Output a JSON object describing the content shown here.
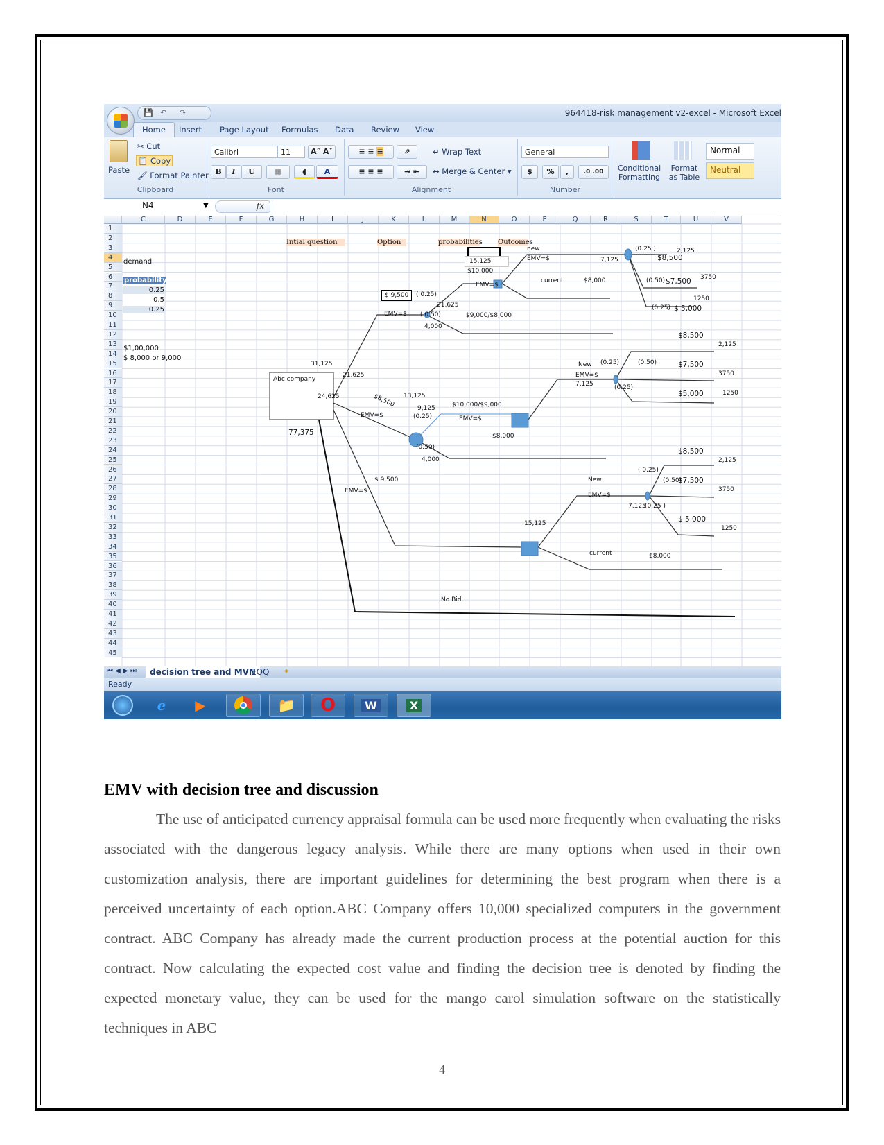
{
  "excel": {
    "window_title": "964418-risk management v2-excel - Microsoft Excel",
    "ribbon_tabs": [
      "Home",
      "Insert",
      "Page Layout",
      "Formulas",
      "Data",
      "Review",
      "View"
    ],
    "clipboard": {
      "paste": "Paste",
      "cut": "Cut",
      "copy": "Copy",
      "format_painter": "Format Painter",
      "label": "Clipboard"
    },
    "font": {
      "name": "Calibri",
      "size": "11",
      "bold": "B",
      "italic": "I",
      "underline": "U",
      "label": "Font"
    },
    "alignment": {
      "wrap_text": "Wrap Text",
      "merge_center": "Merge & Center",
      "label": "Alignment"
    },
    "number": {
      "format": "General",
      "currency": "$",
      "percent": "%",
      "comma": ",",
      "label": "Number"
    },
    "styles": {
      "conditional_formatting": "Conditional Formatting",
      "format_as_table": "Format as Table",
      "normal": "Normal",
      "neutral": "Neutral"
    },
    "name_box": "N4",
    "fx_label": "fx",
    "columns": [
      "C",
      "D",
      "E",
      "F",
      "G",
      "H",
      "I",
      "J",
      "K",
      "L",
      "M",
      "N",
      "O",
      "P",
      "Q",
      "R",
      "S",
      "T",
      "U",
      "V"
    ],
    "selected_column": "N",
    "rows": [
      "1",
      "2",
      "3",
      "4",
      "5",
      "6",
      "7",
      "8",
      "9",
      "10",
      "11",
      "12",
      "13",
      "14",
      "15",
      "16",
      "17",
      "18",
      "19",
      "20",
      "21",
      "22",
      "23",
      "24",
      "25",
      "26",
      "27",
      "28",
      "29",
      "30",
      "31",
      "32",
      "33",
      "34",
      "35",
      "36",
      "37",
      "38",
      "39",
      "40",
      "41",
      "42",
      "43",
      "44",
      "45"
    ],
    "selected_row": "4",
    "cells": {
      "demand": "demand",
      "probability_header": "probability",
      "probabilities": [
        "0.25",
        "0.5",
        "0.25"
      ],
      "amount_1": "$1,00,000",
      "amount_2": "$ 8,000 or 9,000",
      "initial_question": "Intial question",
      "option": "Option",
      "probabilities_header": "probabilities",
      "outcomes": "Outcomes"
    },
    "tree_labels": {
      "root": "Abc company",
      "root_total": "77,375",
      "v31125": "31,125",
      "v21625_a": "21,625",
      "v24625": "24,625",
      "bid_9500_box": "$ 9,500",
      "emv_a": "EMV=$",
      "p025_a": "( 0.25)",
      "p050_a": "( 0.50)",
      "v21625_b": "21,625",
      "v4000_a": "4,000",
      "s9000_8000": "$9,000/$8,000",
      "v15125_box": "15,125",
      "v10000": "$10,000",
      "emv_b": "EMV=$",
      "new_a": "new",
      "emv_new_a": "EMV=$",
      "current_a": "current",
      "current_a_val": "$8,000",
      "v7125_a": "7,125",
      "p025_b": "(0.25 )",
      "s8500_a": "$8,500",
      "v2125_a": "2,125",
      "p050_b": "(0.50)",
      "s7500_a": "$7,500",
      "v3750_a": "3750",
      "v1250_a": "1250",
      "p025_c": "(0.25)",
      "s5000_a": "$ 5,000",
      "bid_8500_diag": "$8,500",
      "emv_c": "EMV=$",
      "v13125": "13,125",
      "v9125": "9,125",
      "p025_d": "(0.25)",
      "s10000_9000": "$10,000/$9,000",
      "emv_d": "EMV=$",
      "s8000_b": "$8,000",
      "p050_c": "(0.50)",
      "v4000_b": "4,000",
      "new_b": "New",
      "p025_e": "(0.25)",
      "emv_new_b": "EMV=$",
      "v7125_b": "7,125",
      "p050_d": "(0.50)",
      "p025_f": "(0.25)",
      "s8500_b": "$8,500",
      "v2125_b": "2,125",
      "s7500_b": "$7,500",
      "v3750_b": "3750",
      "s5000_b": "$5,000",
      "v1250_b": "1250",
      "bid_9500_diag": "$ 9,500",
      "emv_e": "EMV=$",
      "v15125_b": "15,125",
      "new_c": "New",
      "emv_new_c": "EMV=$",
      "p025_g": "( 0.25)",
      "p050_e": "(0.50)",
      "v7125_c": "7,125",
      "p025_h": "(0.25 )",
      "s8500_c": "$8,500",
      "v2125_c": "2,125",
      "s7500_c": "$7,500",
      "v3750_c": "3750",
      "s5000_c": "$ 5,000",
      "v1250_c": "1250",
      "current_c": "current",
      "current_c_val": "$8,000",
      "no_bid": "No Bid"
    },
    "sheet_tabs": [
      "decision tree and MVN",
      "EOQ"
    ],
    "active_sheet": "decision tree and MVN",
    "status": "Ready",
    "taskbar_apps": [
      "start-orb",
      "internet-explorer",
      "media-player",
      "chrome",
      "file-explorer",
      "opera",
      "word",
      "excel"
    ]
  },
  "document": {
    "heading": "EMV with decision tree and discussion",
    "paragraph": "The use of anticipated currency appraisal formula can be used more frequently when evaluating the risks associated with the dangerous legacy analysis. While there are many options when used in their own customization analysis, there are important guidelines for determining the best program when there is a perceived uncertainty of each option.ABC Company offers 10,000 specialized computers in the government contract. ABC Company has already made the current production process at the potential auction for this contract. Now calculating the expected cost value and finding the decision tree is denoted by finding the expected monetary value, they can be used for the mango carol simulation software on the statistically techniques in ABC",
    "page_number": "4"
  }
}
